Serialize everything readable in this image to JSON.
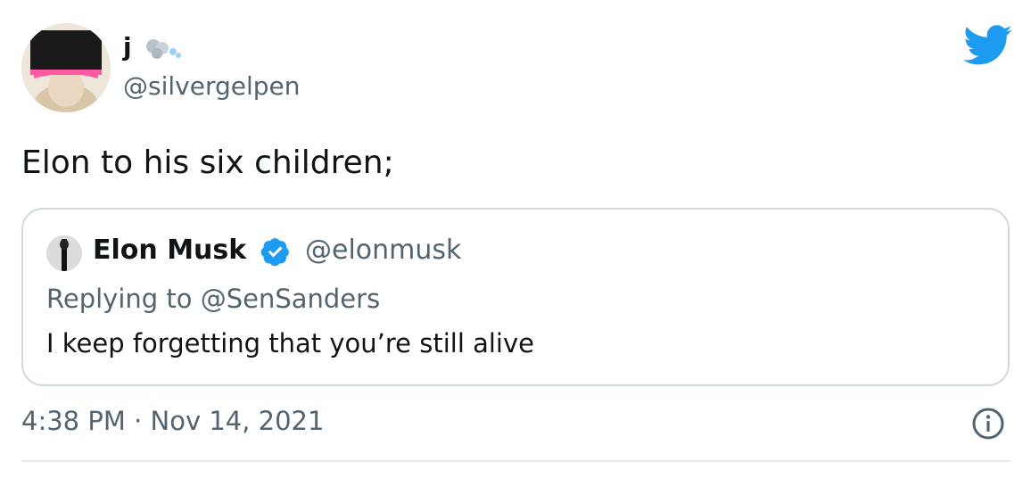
{
  "author": {
    "name": "j",
    "handle": "@silvergelpen",
    "emoji": "dash-icon"
  },
  "tweet": {
    "text": "Elon to his six children;"
  },
  "quote": {
    "name": "Elon Musk",
    "handle": "@elonmusk",
    "replying_to": "Replying to @SenSanders",
    "text": "I keep forgetting that you’re still alive",
    "verified": true
  },
  "meta": {
    "timestamp": "4:38 PM · Nov 14, 2021"
  },
  "icons": {
    "brand": "twitter-bird-icon",
    "info": "info-icon",
    "verified": "verified-badge-icon"
  },
  "colors": {
    "brand_blue": "#1d9bf0",
    "secondary_text": "#536471",
    "border": "#cfd9de"
  }
}
